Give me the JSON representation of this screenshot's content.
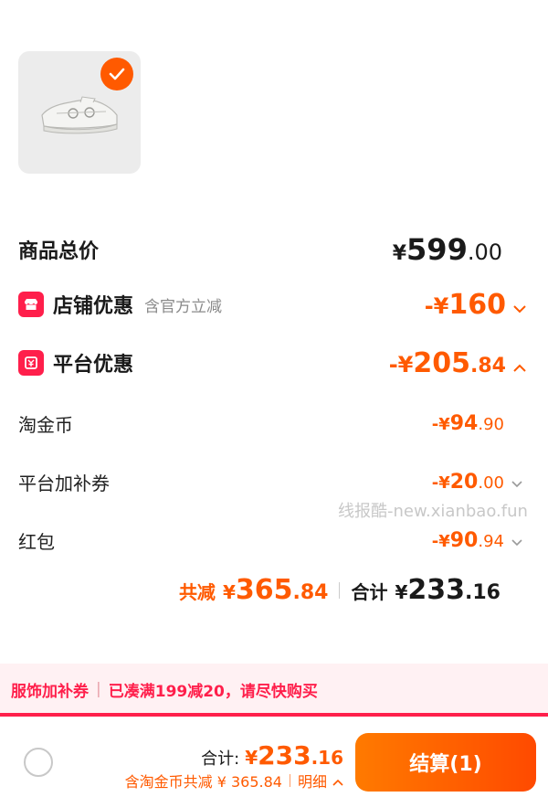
{
  "product": {
    "selected": true
  },
  "rows": {
    "total": {
      "label": "商品总价",
      "currency": "¥",
      "int": "599",
      "dec": ".00"
    },
    "shop": {
      "label": "店铺优惠",
      "sub": "含官方立减",
      "prefix": "-¥",
      "int": "160",
      "dec": ""
    },
    "platform": {
      "label": "平台优惠",
      "prefix": "-¥",
      "int": "205",
      "dec": ".84"
    },
    "coins": {
      "label": "淘金币",
      "prefix": "-¥",
      "int": "94",
      "dec": ".90"
    },
    "coupon": {
      "label": "平台加补券",
      "prefix": "-¥",
      "int": "20",
      "dec": ".00"
    },
    "redpack": {
      "label": "红包",
      "prefix": "-¥",
      "int": "90",
      "dec": ".94"
    }
  },
  "summary": {
    "saved_label": "共减",
    "saved_cur": "¥",
    "saved_int": "365",
    "saved_dec": ".84",
    "total_label": "合计",
    "total_cur": "¥",
    "total_int": "233",
    "total_dec": ".16"
  },
  "watermark": "线报酷-new.xianbao.fun",
  "promo": {
    "tag": "服饰加补券",
    "sep": "|",
    "text": "已凑满199减20，请尽快购买"
  },
  "bottom": {
    "total_label": "合计:",
    "total_cur": "¥",
    "total_int": "233",
    "total_dec": ".16",
    "deduct_text": "含淘金币共减 ¥ 365.84",
    "detail_label": "明细",
    "checkout_label": "结算(1)"
  },
  "colors": {
    "accent": "#ff5a00",
    "brand_red": "#ff1f4b",
    "promo_bg": "#fff1f3"
  }
}
